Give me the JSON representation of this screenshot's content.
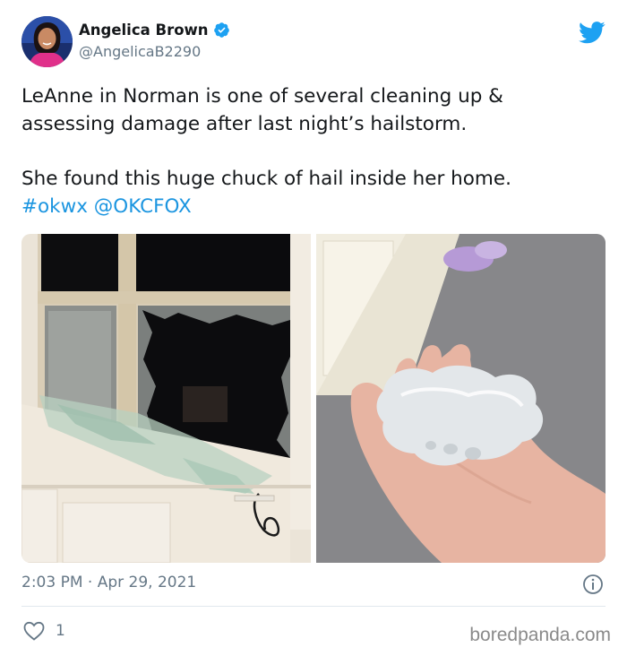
{
  "colors": {
    "text": "#14171a",
    "secondary": "#657786",
    "link": "#1b95e0",
    "verified": "#1da1f2",
    "divider": "#e1e8ed"
  },
  "author": {
    "display_name": "Angelica Brown",
    "handle": "@AngelicaB2290",
    "verified_icon": "verified-badge-icon",
    "avatar_icon": "avatar"
  },
  "tweet": {
    "line1": "LeAnne in Norman is one of several cleaning up &",
    "line2": "assessing damage after last night’s hailstorm.",
    "line3": "She found this huge chuck of hail inside her home.",
    "hashtag": "#okwx",
    "mention": "@OKCFOX"
  },
  "media": [
    {
      "icon": "broken-window-photo"
    },
    {
      "icon": "hail-in-hand-photo"
    }
  ],
  "meta": {
    "timestamp": "2:03 PM · Apr 29, 2021",
    "info_icon": "info-icon"
  },
  "actions": {
    "like_icon": "heart-icon",
    "like_count": "1"
  },
  "watermark": "boredpanda.com"
}
